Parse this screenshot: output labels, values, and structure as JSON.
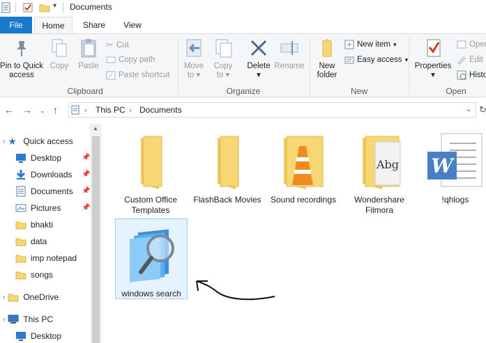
{
  "window": {
    "title": "Documents"
  },
  "tabs": [
    "File",
    "Home",
    "Share",
    "View"
  ],
  "ribbon": {
    "clipboard": {
      "label": "Clipboard",
      "pin": "Pin to Quick access",
      "copy": "Copy",
      "paste": "Paste",
      "cut": "Cut",
      "copy_path": "Copy path",
      "paste_shortcut": "Paste shortcut"
    },
    "organize": {
      "label": "Organize",
      "move_to": "Move to",
      "copy_to": "Copy to",
      "delete": "Delete",
      "rename": "Rename"
    },
    "new": {
      "label": "New",
      "new_folder": "New folder",
      "new_item": "New item",
      "easy_access": "Easy access"
    },
    "open": {
      "label": "Open",
      "properties": "Properties",
      "open": "Open",
      "edit": "Edit",
      "history": "History"
    }
  },
  "address": {
    "crumbs": [
      "This PC",
      "Documents"
    ]
  },
  "navpane": {
    "items": [
      {
        "label": "Quick access",
        "icon": "star-icon",
        "pinned": false
      },
      {
        "label": "Desktop",
        "icon": "desktop-icon",
        "pinned": true
      },
      {
        "label": "Downloads",
        "icon": "downloads-icon",
        "pinned": true
      },
      {
        "label": "Documents",
        "icon": "documents-icon",
        "pinned": true
      },
      {
        "label": "Pictures",
        "icon": "pictures-icon",
        "pinned": true
      },
      {
        "label": "bhakti",
        "icon": "folder-icon",
        "pinned": false
      },
      {
        "label": "data",
        "icon": "folder-icon",
        "pinned": false
      },
      {
        "label": "imp notepad",
        "icon": "folder-icon",
        "pinned": false
      },
      {
        "label": "songs",
        "icon": "folder-icon",
        "pinned": false
      },
      {
        "label": "OneDrive",
        "icon": "folder-icon",
        "pinned": false
      },
      {
        "label": "This PC",
        "icon": "computer-icon",
        "pinned": false
      },
      {
        "label": "Desktop",
        "icon": "desktop-icon",
        "pinned": false
      }
    ]
  },
  "files": [
    {
      "name": "Custom Office Templates",
      "icon": "folder-icon"
    },
    {
      "name": "FlashBack Movies",
      "icon": "folder-icon"
    },
    {
      "name": "Sound recordings",
      "icon": "vlc-folder-icon"
    },
    {
      "name": "Wondershare Filmora",
      "icon": "font-folder-icon"
    },
    {
      "name": "!qhlogs",
      "icon": "word-doc-icon"
    },
    {
      "name": "windows search",
      "icon": "search-index-icon"
    }
  ],
  "colors": {
    "accent": "#1979ca",
    "folder": "#f7d774",
    "selection": "#e5f3ff"
  }
}
